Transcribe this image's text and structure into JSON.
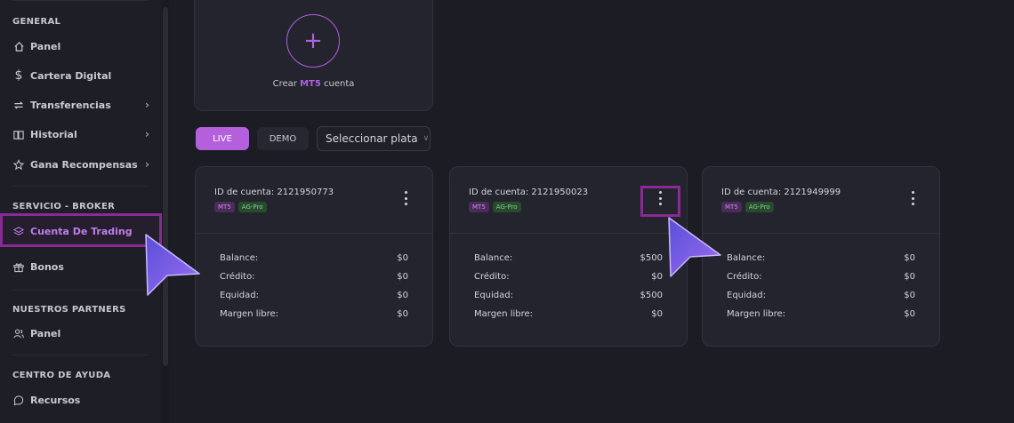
{
  "sidebar": {
    "sections": [
      {
        "title": "GENERAL"
      },
      {
        "title": "SERVICIO - BROKER"
      },
      {
        "title": "NUESTROS PARTNERS"
      },
      {
        "title": "CENTRO DE AYUDA"
      }
    ],
    "items": [
      {
        "label": "Panel",
        "icon": "home-icon"
      },
      {
        "label": "Cartera Digital",
        "icon": "dollar-icon"
      },
      {
        "label": "Transferencias",
        "icon": "transfer-icon"
      },
      {
        "label": "Historial",
        "icon": "book-icon"
      },
      {
        "label": "Gana Recompensas",
        "icon": "star-icon"
      },
      {
        "label": "Cuenta De Trading",
        "icon": "layers-icon",
        "active": true
      },
      {
        "label": "Bonos",
        "icon": "gift-icon"
      },
      {
        "label": "Panel",
        "icon": "users-icon"
      },
      {
        "label": "Recursos",
        "icon": "help-icon"
      }
    ]
  },
  "create": {
    "prefix": "Crear",
    "platform": "MT5",
    "suffix": "cuenta"
  },
  "tabs": {
    "live": "LIVE",
    "demo": "DEMO"
  },
  "select": {
    "value": "Seleccionar plata"
  },
  "accounts": [
    {
      "id_label": "ID de cuenta: 2121950773",
      "badges": [
        "MT5",
        "AG-Pro"
      ],
      "rows": [
        {
          "label": "Balance:",
          "value": "$0"
        },
        {
          "label": "Crédito:",
          "value": "$0"
        },
        {
          "label": "Equidad:",
          "value": "$0"
        },
        {
          "label": "Margen libre:",
          "value": "$0"
        }
      ]
    },
    {
      "id_label": "ID de cuenta: 2121950023",
      "badges": [
        "MT5",
        "AG-Pro"
      ],
      "rows": [
        {
          "label": "Balance:",
          "value": "$500"
        },
        {
          "label": "Crédito:",
          "value": "$0"
        },
        {
          "label": "Equidad:",
          "value": "$500"
        },
        {
          "label": "Margen libre:",
          "value": "$0"
        }
      ]
    },
    {
      "id_label": "ID de cuenta: 2121949999",
      "badges": [
        "MT5",
        "AG-Pro"
      ],
      "rows": [
        {
          "label": "Balance:",
          "value": "$0"
        },
        {
          "label": "Crédito:",
          "value": "$0"
        },
        {
          "label": "Equidad:",
          "value": "$0"
        },
        {
          "label": "Margen libre:",
          "value": "$0"
        }
      ]
    }
  ],
  "colors": {
    "accent": "#b460dc",
    "highlight_box": "#8a2a95",
    "cursor": "#7b5ce6"
  }
}
